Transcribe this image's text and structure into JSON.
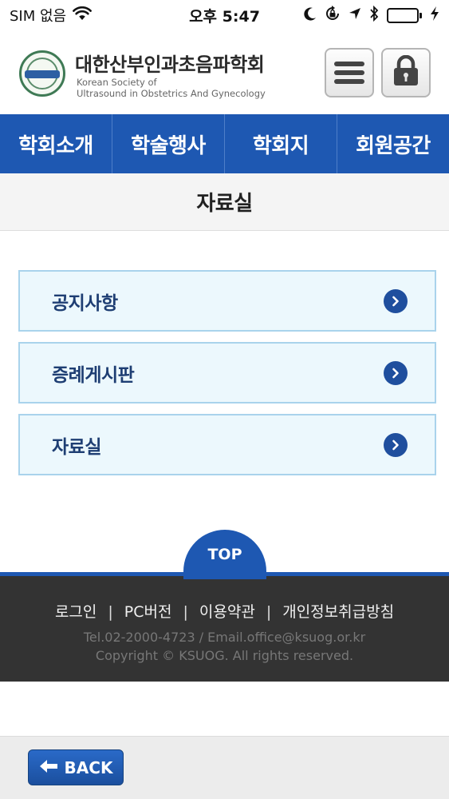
{
  "status_bar": {
    "carrier": "SIM 없음",
    "time": "오후 5:47",
    "battery_level": 0.8
  },
  "header": {
    "org_name_ko": "대한산부인과초음파학회",
    "org_name_en_line1": "Korean Society of",
    "org_name_en_line2": "Ultrasound in Obstetrics And Gynecology"
  },
  "nav": {
    "items": [
      {
        "label": "학회소개"
      },
      {
        "label": "학술행사"
      },
      {
        "label": "학회지"
      },
      {
        "label": "회원공간"
      }
    ]
  },
  "page": {
    "title": "자료실"
  },
  "menu": {
    "items": [
      {
        "label": "공지사항"
      },
      {
        "label": "증례게시판"
      },
      {
        "label": "자료실"
      }
    ]
  },
  "top_button": {
    "label": "TOP"
  },
  "footer": {
    "links": [
      {
        "label": "로그인"
      },
      {
        "label": "PC버전"
      },
      {
        "label": "이용약관"
      },
      {
        "label": "개인정보취급방침"
      }
    ],
    "separator": "|",
    "contact": "Tel.02-2000-4723 / Email.office@ksuog.or.kr",
    "copyright": "Copyright © KSUOG. All rights reserved."
  },
  "bottom": {
    "back_label": "BACK"
  },
  "colors": {
    "primary": "#1e58b2",
    "menu_bg": "#ecf8fd",
    "menu_border": "#a9d3ec",
    "footer_bg": "#333333"
  }
}
